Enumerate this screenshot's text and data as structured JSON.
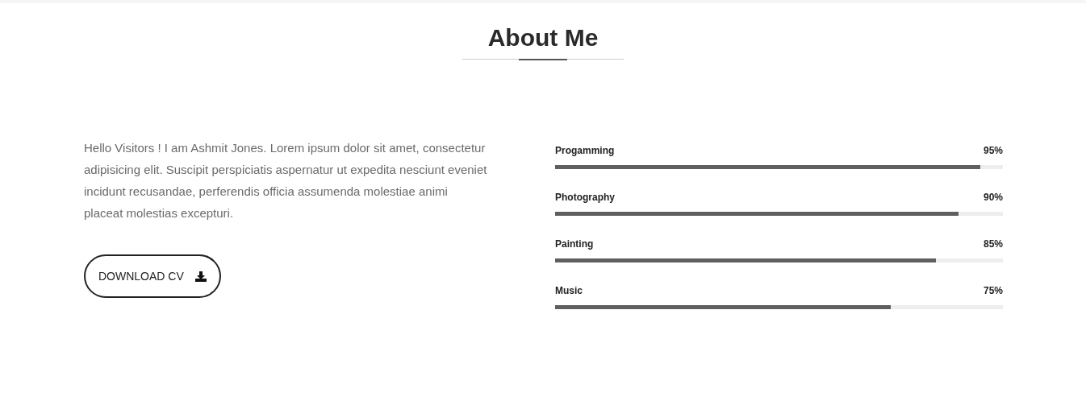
{
  "heading": "About Me",
  "intro": "Hello Visitors ! I am Ashmit Jones. Lorem ipsum dolor sit amet, consectetur adipisicing elit. Suscipit perspiciatis aspernatur ut expedita nesciunt eveniet incidunt recusandae, perferendis officia assumenda molestiae animi placeat molestias excepturi.",
  "download_button": {
    "label": "DOWNLOAD CV"
  },
  "skills": [
    {
      "name": "Progamming",
      "reading": "95%",
      "level": 0.95
    },
    {
      "name": "Photography",
      "reading": "90%",
      "level": 0.9
    },
    {
      "name": "Painting",
      "reading": "85%",
      "level": 0.85
    },
    {
      "name": "Music",
      "reading": "75%",
      "level": 0.75
    }
  ]
}
